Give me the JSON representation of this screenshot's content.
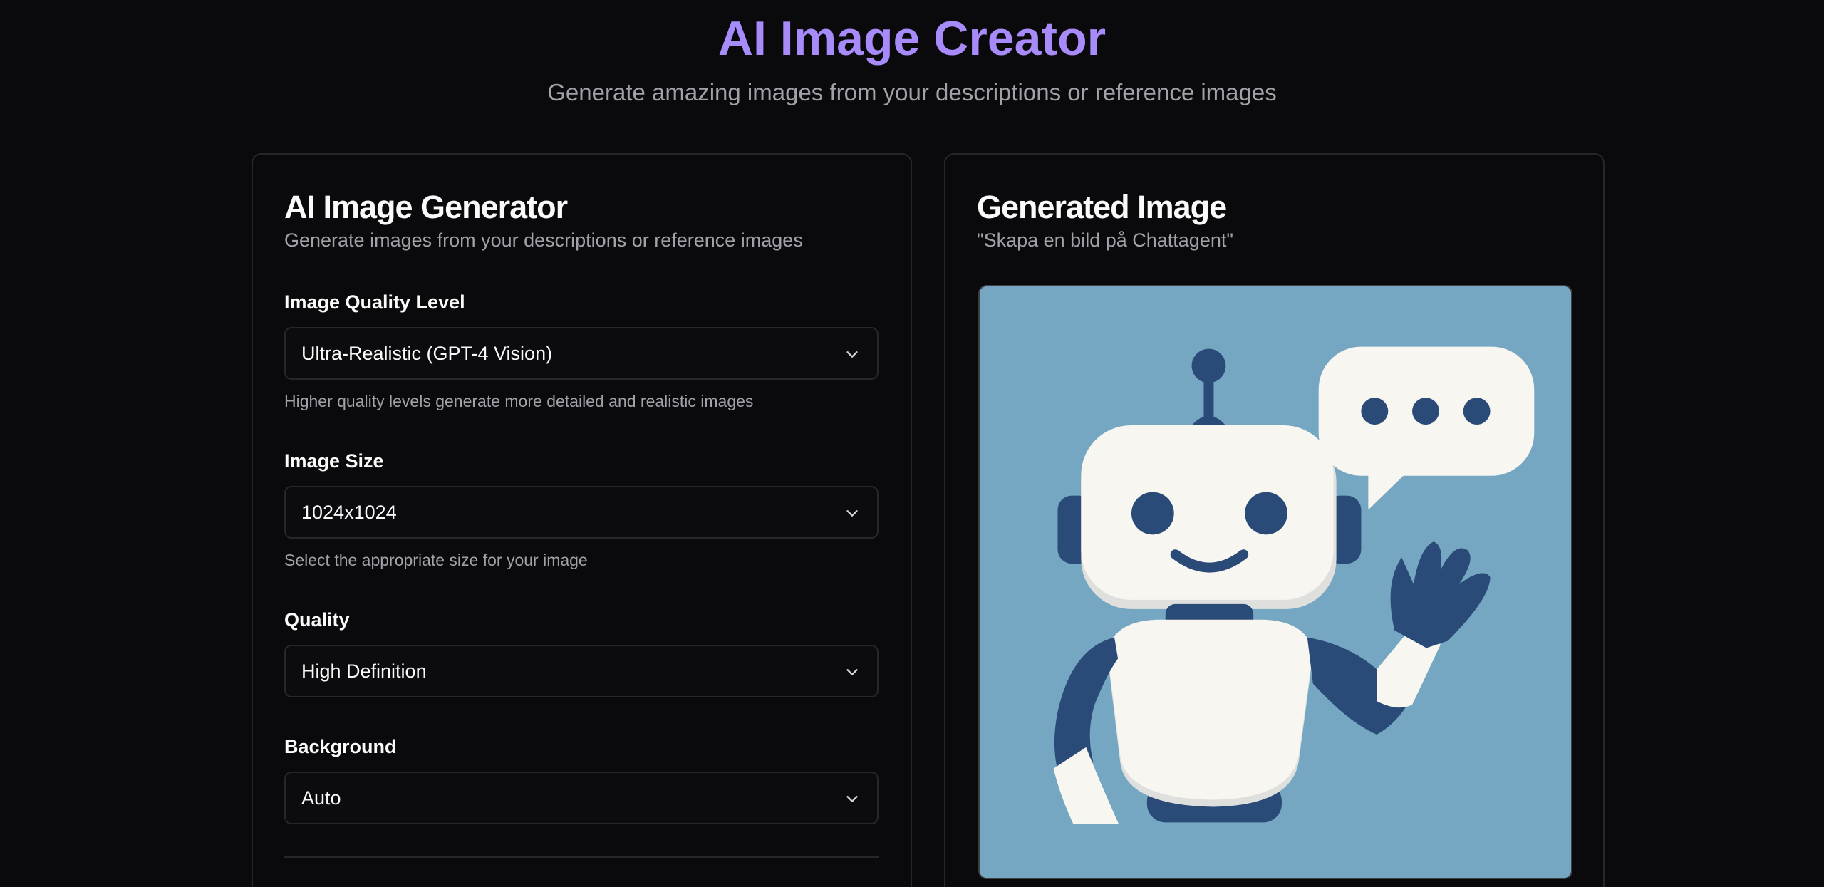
{
  "header": {
    "title": "AI Image Creator",
    "subtitle": "Generate amazing images from your descriptions or reference images"
  },
  "generator": {
    "title": "AI Image Generator",
    "description": "Generate images from your descriptions or reference images",
    "fields": {
      "quality_level": {
        "label": "Image Quality Level",
        "value": "Ultra-Realistic (GPT-4 Vision)",
        "hint": "Higher quality levels generate more detailed and realistic images"
      },
      "size": {
        "label": "Image Size",
        "value": "1024x1024",
        "hint": "Select the appropriate size for your image"
      },
      "quality": {
        "label": "Quality",
        "value": "High Definition"
      },
      "background": {
        "label": "Background",
        "value": "Auto"
      }
    }
  },
  "result": {
    "title": "Generated Image",
    "prompt": "\"Skapa en bild på Chattagent\"",
    "image_subject": "robot-mascot-waving-with-speech-bubble"
  },
  "icons": {
    "chevron": "chevron-down-icon"
  },
  "colors": {
    "accent": "#a78bfa",
    "background": "#0a0a0c",
    "border": "#27272a",
    "image_bg": "#76a7c2",
    "robot_navy": "#2a4a78",
    "robot_white": "#f8f6f0"
  }
}
